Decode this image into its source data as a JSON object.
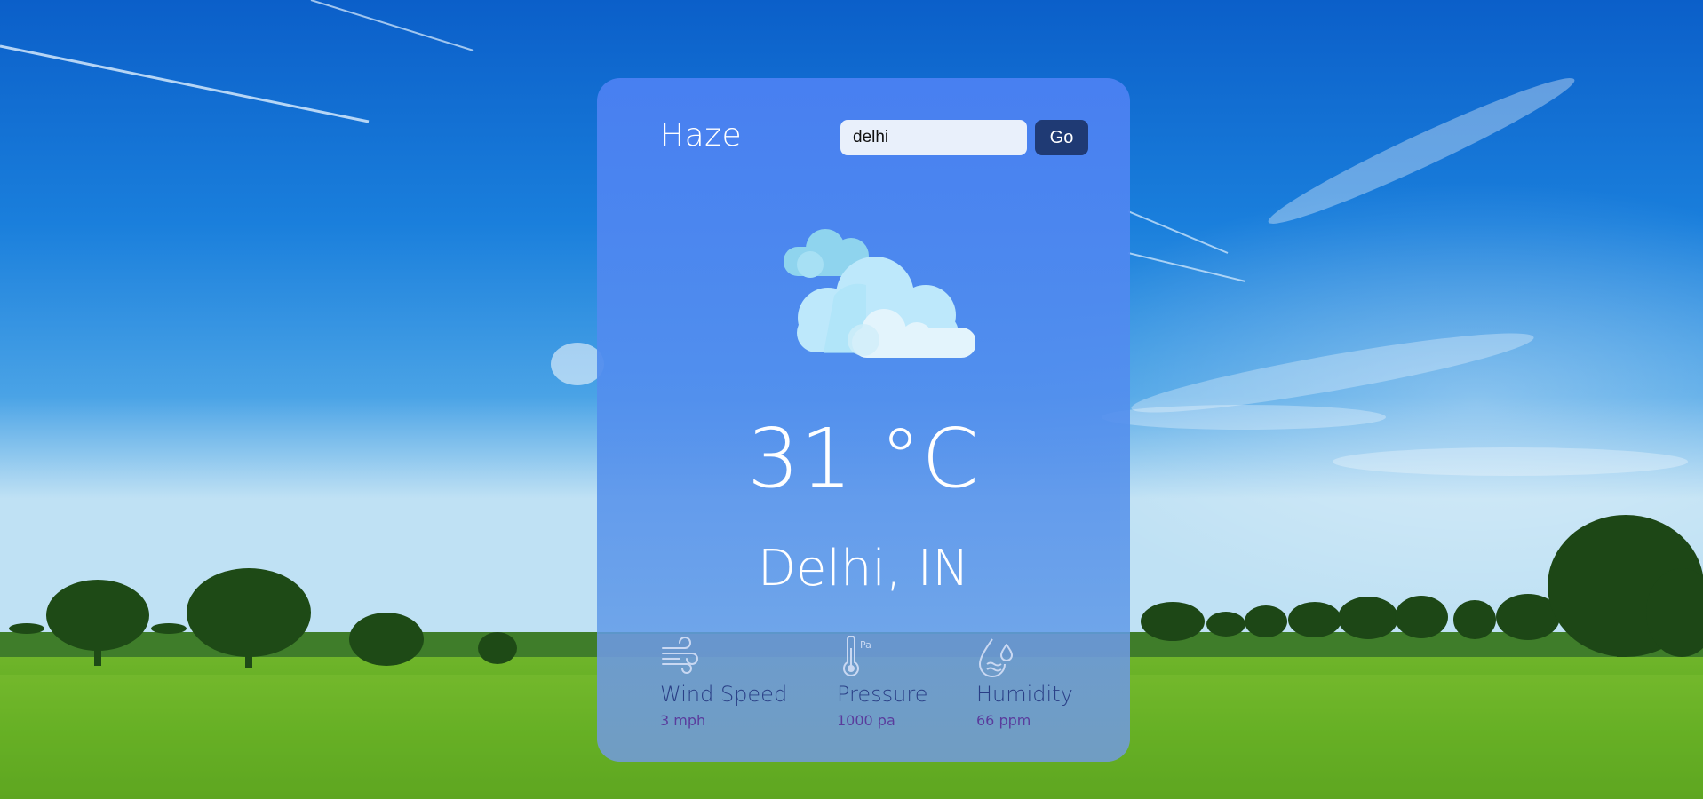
{
  "weather": {
    "condition": "Haze",
    "temperature": "31 °C",
    "location": "Delhi, IN"
  },
  "search": {
    "value": "delhi",
    "button_label": "Go"
  },
  "stats": {
    "wind": {
      "label": "Wind Speed",
      "value": "3 mph",
      "icon": "wind-icon"
    },
    "pressure": {
      "label": "Pressure",
      "value": "1000 pa",
      "icon": "thermometer-pressure-icon"
    },
    "humidity": {
      "label": "Humidity",
      "value": "66 ppm",
      "icon": "humidity-drops-icon"
    }
  },
  "colors": {
    "card_top": "#4a80f2",
    "button": "#1f3a74",
    "input_bg": "#e9f0fb",
    "stat_label": "#2a3f86",
    "stat_value": "#5a3c9c"
  }
}
